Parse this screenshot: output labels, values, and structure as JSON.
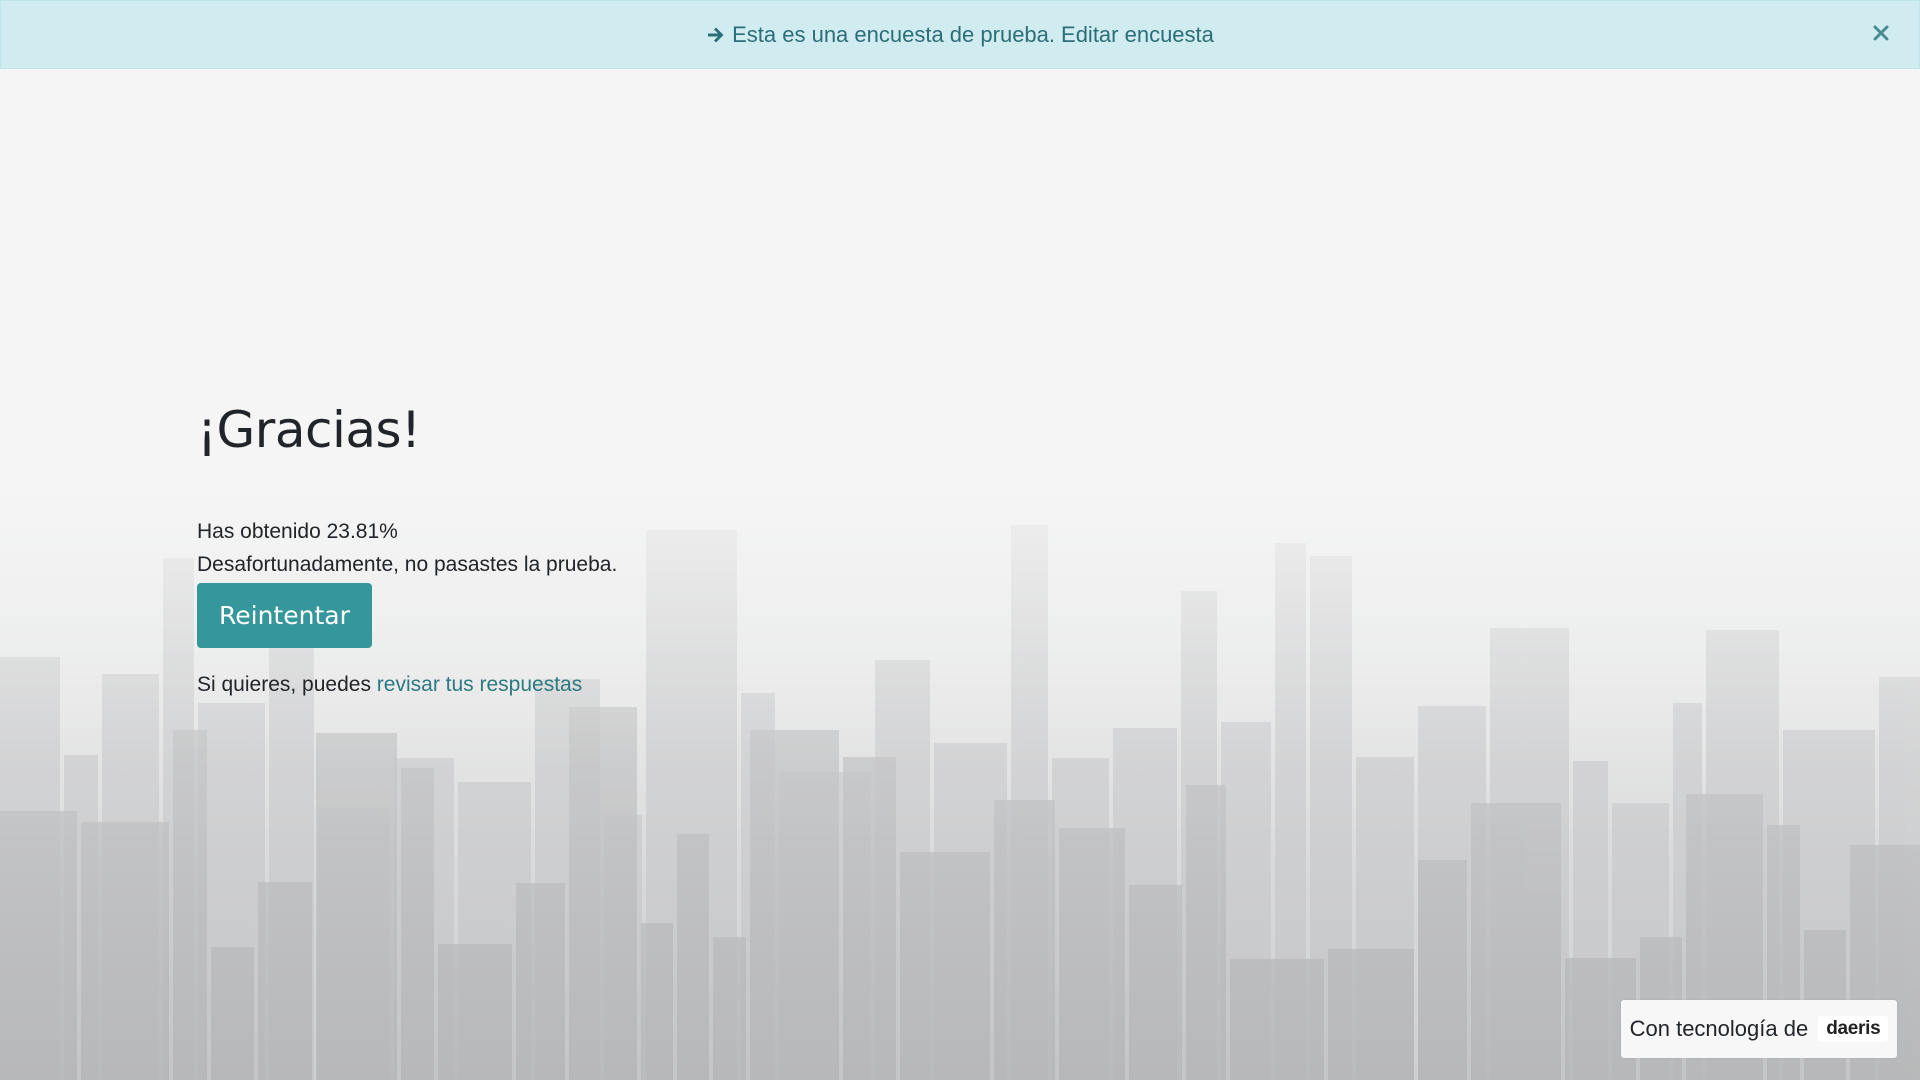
{
  "banner": {
    "message": "Esta es una encuesta de prueba.",
    "edit_link": "Editar encuesta",
    "arrow_icon": "arrow-right-icon",
    "close_icon": "close-icon"
  },
  "result": {
    "title": "¡Gracias!",
    "score_text": "Has obtenido 23.81%",
    "fail_text": "Desafortunadamente, no pasastes la prueba.",
    "retry_label": "Reintentar",
    "review_prefix": "Si quieres, puedes",
    "review_link": "revisar tus respuestas"
  },
  "footer": {
    "powered_by": "Con tecnología de",
    "brand": "daeris"
  },
  "colors": {
    "banner_bg": "#d1ecf1",
    "banner_text": "#2c6e78",
    "button_bg": "#35979c",
    "link": "#2c7a82"
  }
}
